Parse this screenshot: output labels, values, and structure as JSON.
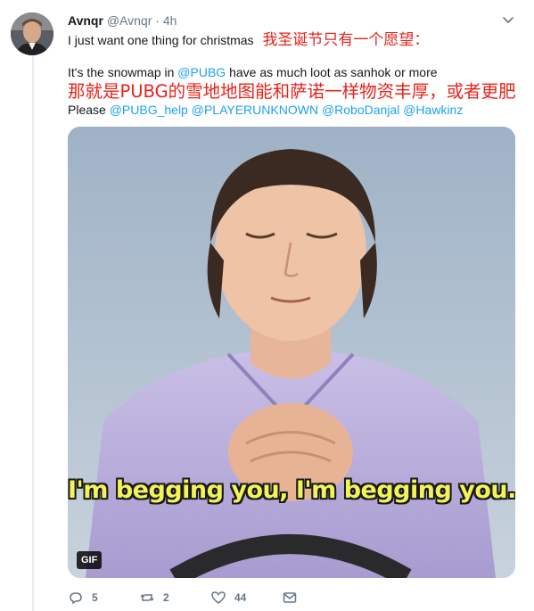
{
  "tweet": {
    "author_name": "Avnqr",
    "handle": "@Avnqr",
    "separator": "·",
    "time": "4h",
    "line1": "I just want one thing for christmas",
    "line1_cn": "我圣诞节只有一个愿望：",
    "line2_prefix": "It's the snowmap in ",
    "line2_mention": "@PUBG",
    "line2_suffix": " have as much loot as sanhok or more",
    "line2_cn": "那就是PUBG的雪地地图能和萨诺一样物资丰厚，或者更肥",
    "line3_prefix": "Please ",
    "mentions": [
      "@PUBG_help",
      "@PLAYERUNKNOWN",
      "@RoboDanjal",
      "@Hawkinz"
    ]
  },
  "media": {
    "caption": "I'm begging you, I'm begging you.",
    "badge": "GIF"
  },
  "actions": {
    "reply_count": "5",
    "retweet_count": "2",
    "like_count": "44"
  },
  "icons": [
    "chevron-down-icon",
    "reply-icon",
    "retweet-icon",
    "like-icon",
    "message-icon"
  ],
  "colors": {
    "link": "#1da1f2",
    "annotation": "#e8221a",
    "meta": "#657786"
  }
}
